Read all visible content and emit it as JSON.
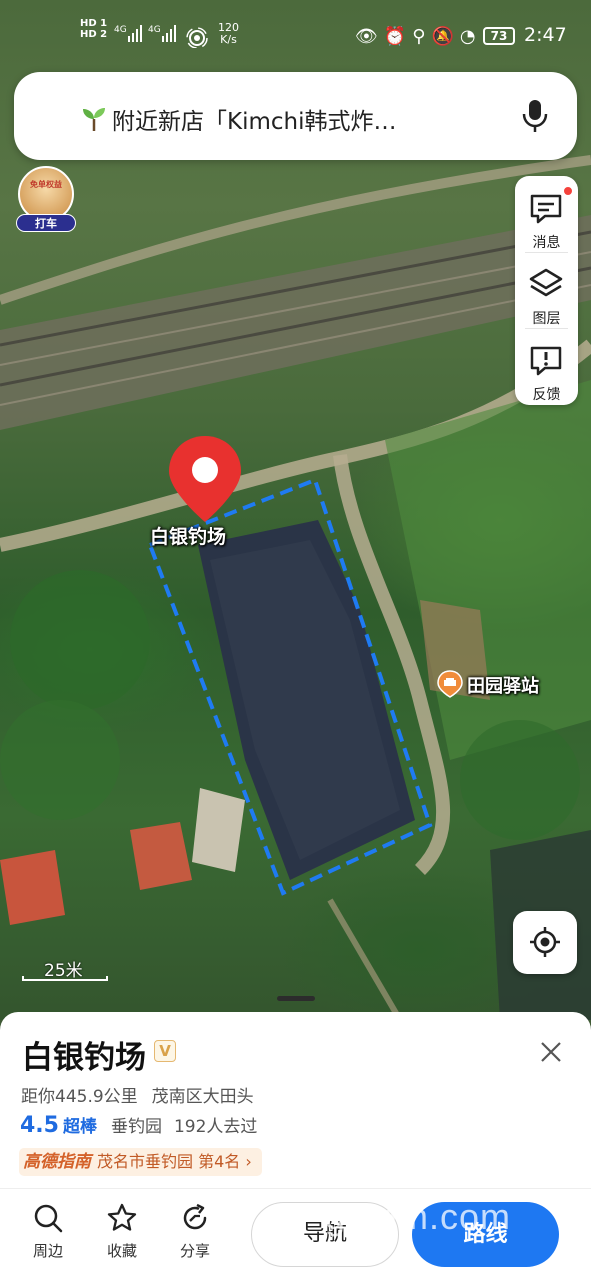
{
  "status_bar": {
    "sim1": "HD 1",
    "sim2": "HD 2",
    "network_speed_value": "120",
    "network_speed_unit": "K/s",
    "battery": "73",
    "time": "2:47"
  },
  "search": {
    "text": "附近新店「Kimchi韩式炸…",
    "icon": "sprout-icon"
  },
  "taxi_badge": {
    "promo": "免单权益",
    "label": "打车"
  },
  "tools": [
    {
      "label": "消息",
      "icon": "message-icon",
      "has_dot": true
    },
    {
      "label": "图层",
      "icon": "layers-icon"
    },
    {
      "label": "反馈",
      "icon": "feedback-icon"
    }
  ],
  "map": {
    "pin_label": "白银钓场",
    "poi_label": "田园驿站",
    "scale_label": "25米",
    "accent": "#e8312f",
    "boundary_color": "#1f7bf2"
  },
  "place": {
    "name": "白银钓场",
    "verified_badge": "V",
    "distance": "距你445.9公里",
    "address": "茂南区大田头",
    "score": "4.5",
    "score_label": "超棒",
    "category": "垂钓园",
    "visitors": "192人去过",
    "guide_brand": "高德指南",
    "guide_text": "茂名市垂钓园 第4名 ›"
  },
  "actions": [
    {
      "label": "周边",
      "icon": "search-icon"
    },
    {
      "label": "收藏",
      "icon": "star-icon"
    },
    {
      "label": "分享",
      "icon": "share-icon"
    }
  ],
  "buttons": {
    "navigate": "导航",
    "route": "路线"
  },
  "watermark": "gdmm.com"
}
